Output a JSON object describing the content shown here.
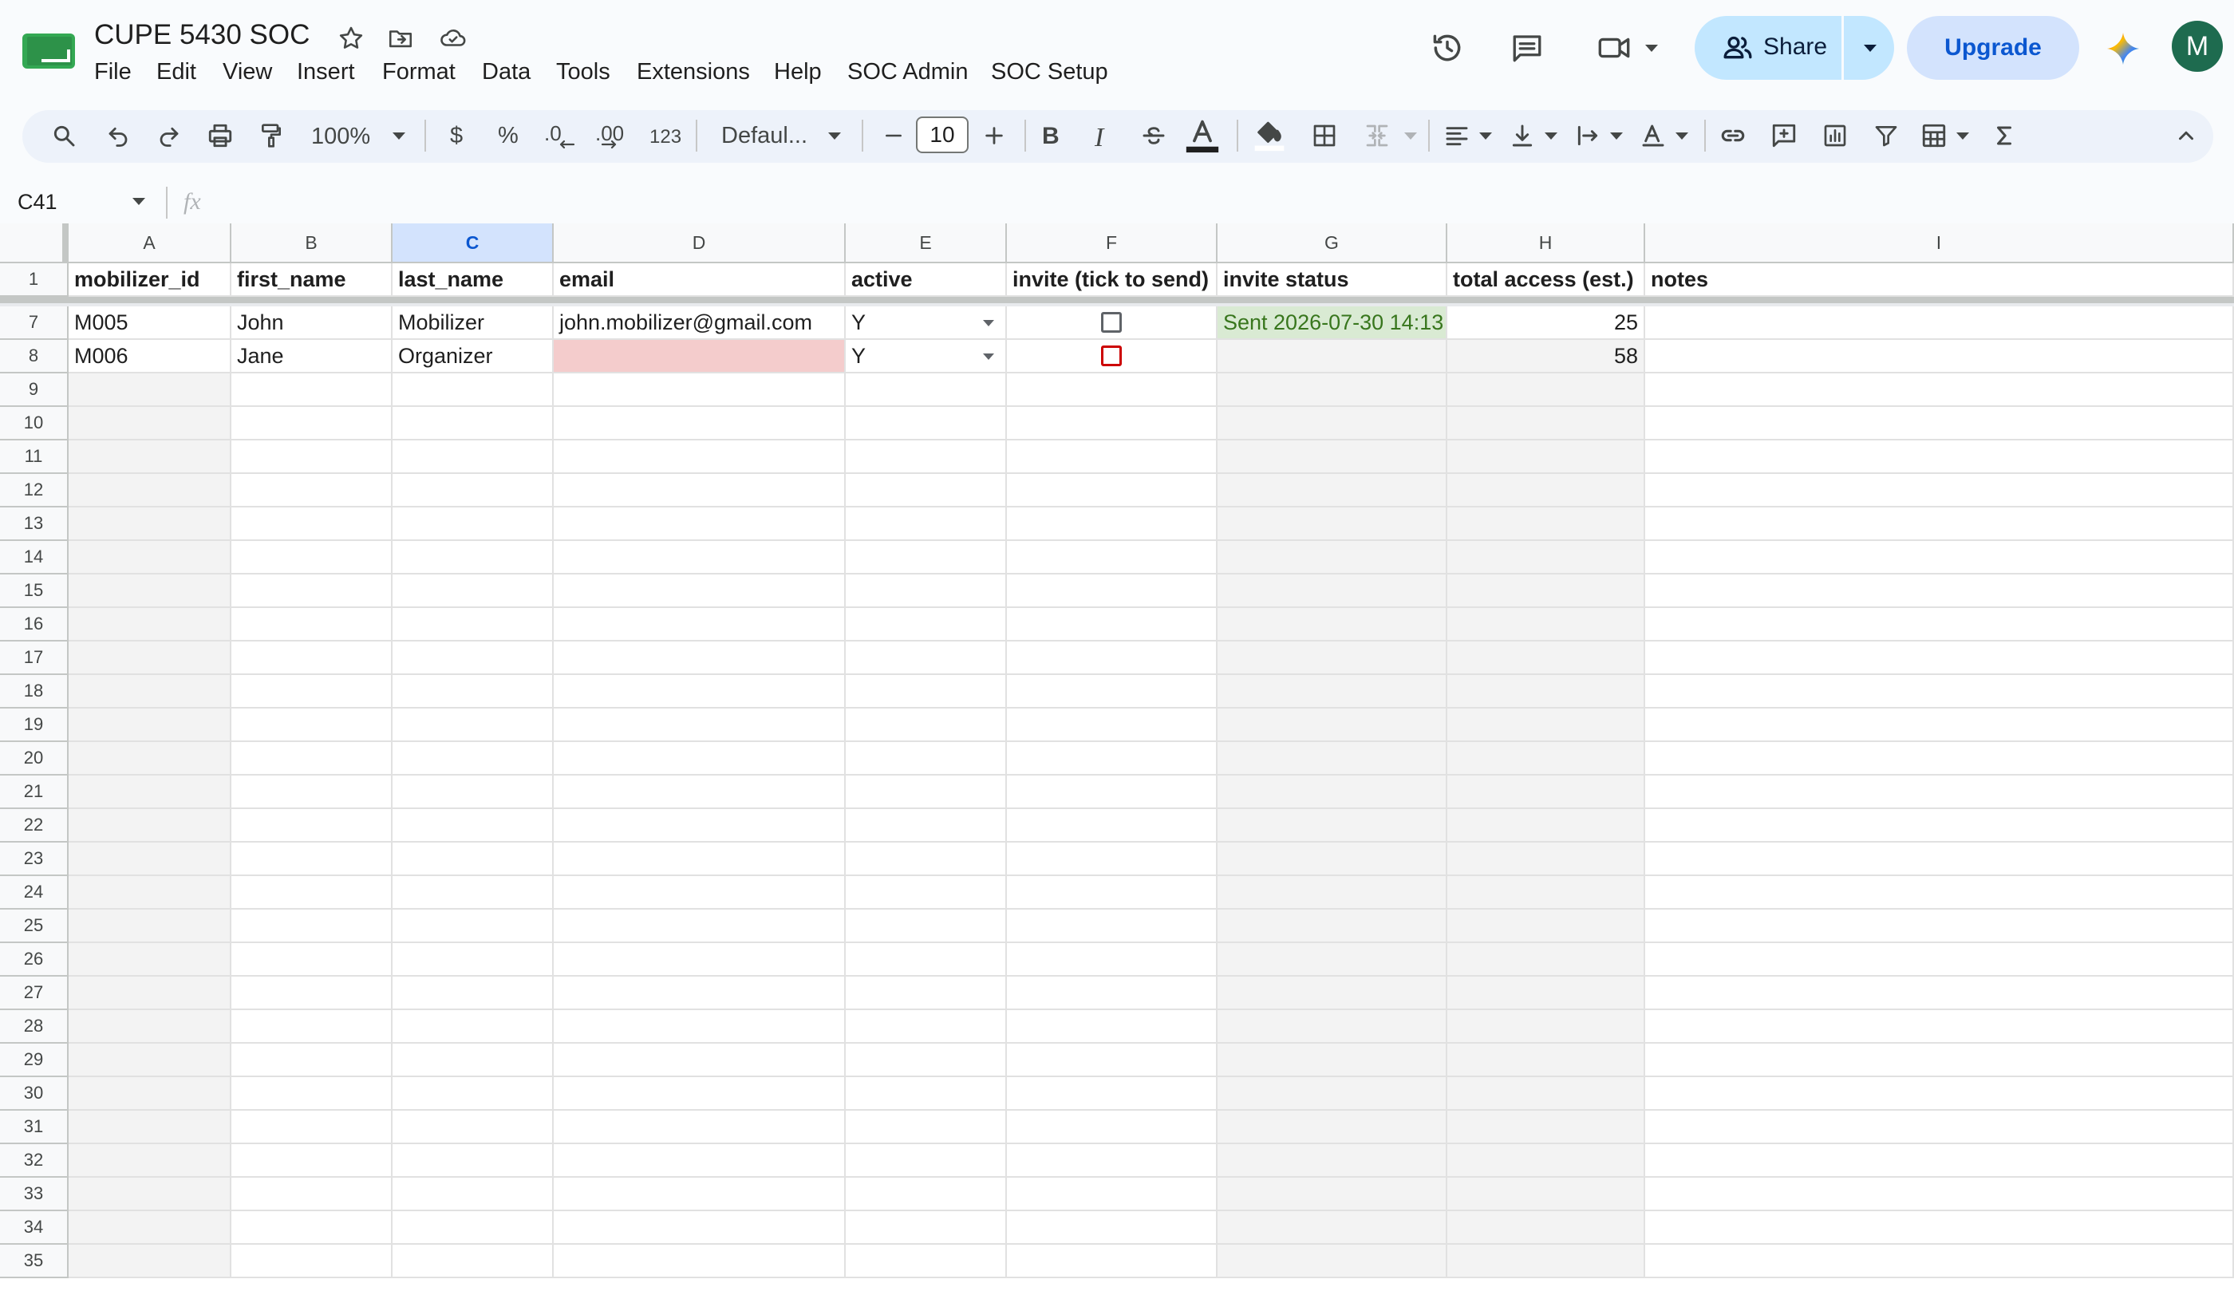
{
  "app": {
    "doc_title": "CUPE 5430 SOC",
    "menus": [
      "File",
      "Edit",
      "View",
      "Insert",
      "Format",
      "Data",
      "Tools",
      "Extensions",
      "Help",
      "SOC Admin",
      "SOC Setup"
    ],
    "share_label": "Share",
    "upgrade_label": "Upgrade",
    "avatar_letter": "M"
  },
  "toolbar": {
    "zoom": "100%",
    "currency": "$",
    "percent": "%",
    "dec_decrease": ".0",
    "dec_increase": ".00",
    "number_format": "123",
    "font": "Defaul...",
    "font_size": "10",
    "bold": "B",
    "italic": "I"
  },
  "formula_bar": {
    "name_box": "C41",
    "fx": "fx",
    "value": ""
  },
  "columns": [
    "A",
    "B",
    "C",
    "D",
    "E",
    "F",
    "G",
    "H",
    "I"
  ],
  "selected_column": "C",
  "header_row": {
    "row_number": "1",
    "cells": [
      "mobilizer_id",
      "first_name",
      "last_name",
      "email",
      "active",
      "invite (tick to send)",
      "invite status",
      "total access (est.)",
      "notes"
    ]
  },
  "data_rows": [
    {
      "row_number": "7",
      "mobilizer_id": "M005",
      "first_name": "John",
      "last_name": "Mobilizer",
      "email": "john.mobilizer@gmail.com",
      "active": "Y",
      "invite_checked": false,
      "invite_status": "Sent 2026-07-30 14:13",
      "total_access": "25",
      "notes": ""
    },
    {
      "row_number": "8",
      "mobilizer_id": "M006",
      "first_name": "Jane",
      "last_name": "Organizer",
      "email": "",
      "active": "Y",
      "invite_checked": false,
      "invite_status": "",
      "total_access": "58",
      "notes": ""
    }
  ],
  "empty_rows": [
    "9",
    "10",
    "11",
    "12",
    "13",
    "14",
    "15",
    "16",
    "17",
    "18",
    "19",
    "20",
    "21",
    "22",
    "23",
    "24",
    "25",
    "26",
    "27",
    "28",
    "29",
    "30",
    "31",
    "32",
    "33",
    "34",
    "35"
  ],
  "colors": {
    "selected_header": "#d3e3fd",
    "invalid_fill": "#f4cccc",
    "status_fill": "#d9ead3",
    "status_text": "#38761d",
    "readonly_fill": "#f3f3f3",
    "invalid_checkbox": "#cc0000",
    "share_button": "#c2e7ff",
    "upgrade_button": "#d3e3fd",
    "avatar": "#1e6b4f"
  }
}
